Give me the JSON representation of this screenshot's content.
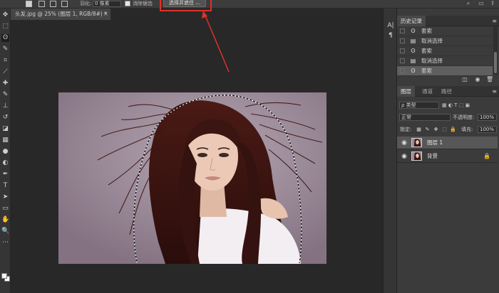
{
  "options_bar": {
    "feather_label": "羽化:",
    "feather_value": "0 像素",
    "antialias_label": "消除锯齿",
    "select_and_mask_label": "选择并遮住 ..."
  },
  "document": {
    "tab_title": "头发.jpg @ 25% (图层 1, RGB/8#) *",
    "close_glyph": "×"
  },
  "toolbar": {
    "tools": [
      "move-icon",
      "marquee-icon",
      "lasso-icon",
      "quick-select-icon",
      "crop-icon",
      "eyedropper-icon",
      "healing-icon",
      "brush-icon",
      "stamp-icon",
      "history-brush-icon",
      "eraser-icon",
      "gradient-icon",
      "blur-icon",
      "dodge-icon",
      "pen-icon",
      "type-icon",
      "path-select-icon",
      "shape-icon",
      "hand-icon",
      "zoom-icon",
      "more-icon"
    ],
    "glyphs": [
      "✥",
      "⬚",
      "ʘ",
      "✎",
      "⌗",
      "⟋",
      "✚",
      "✎",
      "⊥",
      "↺",
      "◪",
      "▦",
      "●",
      "◐",
      "✒",
      "T",
      "➤",
      "▭",
      "✋",
      "🔍",
      "⋯"
    ],
    "active_index": 2
  },
  "mini_column": {
    "items": [
      {
        "icon": "character-icon",
        "glyph": "A|"
      },
      {
        "icon": "paragraph-icon",
        "glyph": "¶"
      }
    ]
  },
  "history_panel": {
    "title": "历史记录",
    "menu_glyph": "≡",
    "items": [
      {
        "label": "套索",
        "icon": "lasso-icon",
        "glyph": "ʘ"
      },
      {
        "label": "取消选择",
        "icon": "document-icon",
        "glyph": "▤"
      },
      {
        "label": "套索",
        "icon": "lasso-icon",
        "glyph": "ʘ"
      },
      {
        "label": "取消选择",
        "icon": "document-icon",
        "glyph": "▤"
      },
      {
        "label": "套索",
        "icon": "lasso-icon",
        "glyph": "ʘ"
      }
    ],
    "footer_glyphs": [
      "◫",
      "◉",
      "🗑"
    ]
  },
  "layers_panel": {
    "tabs": [
      "图层",
      "通道",
      "路径"
    ],
    "active_tab": 0,
    "menu_glyph": "≡",
    "filter_kind": "ρ 类型",
    "blend_mode": "正常",
    "opacity_label": "不透明度:",
    "opacity_value": "100%",
    "lock_label": "锁定:",
    "lock_glyphs": [
      "▦",
      "✎",
      "✥",
      "⬚",
      "🔒"
    ],
    "fill_label": "填充:",
    "fill_value": "100%",
    "layers": [
      {
        "name": "图层 1",
        "visible": true,
        "locked": false,
        "selected": true
      },
      {
        "name": "背景",
        "visible": true,
        "locked": true,
        "selected": false
      }
    ]
  },
  "colors": {
    "highlight": "#e0302a",
    "photo_background": "#9a8797",
    "hair": "#3a1512"
  }
}
